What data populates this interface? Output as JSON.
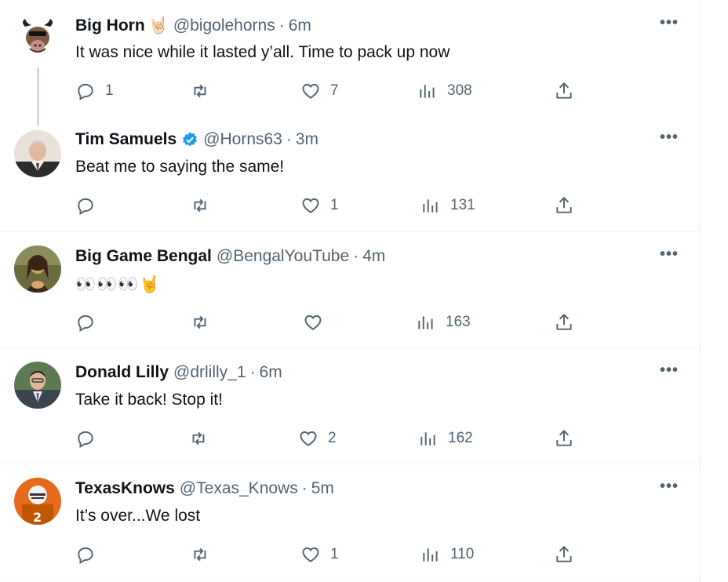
{
  "tweets": [
    {
      "name": "Big Horn",
      "name_suffix": "🤘🏻",
      "handle": "@bigolehorns",
      "time": "6m",
      "text": "It was nice while it lasted y’all. Time to pack up now",
      "replies": "1",
      "retweets": "",
      "likes": "7",
      "views": "308",
      "verified": false
    },
    {
      "name": "Tim Samuels",
      "handle": "@Horns63",
      "time": "3m",
      "text": "Beat me to saying the same!",
      "replies": "",
      "retweets": "",
      "likes": "1",
      "views": "131",
      "verified": true
    },
    {
      "name": "Big Game Bengal",
      "handle": "@BengalYouTube",
      "time": "4m",
      "text": "👀👀👀🤘",
      "replies": "",
      "retweets": "",
      "likes": "",
      "views": "163",
      "verified": false
    },
    {
      "name": "Donald Lilly",
      "handle": "@drlilly_1",
      "time": "6m",
      "text": "Take it back! Stop it!",
      "replies": "",
      "retweets": "",
      "likes": "2",
      "views": "162",
      "verified": false
    },
    {
      "name": "TexasKnows",
      "handle": "@Texas_Knows",
      "time": "5m",
      "text": "It’s over...We lost",
      "replies": "",
      "retweets": "",
      "likes": "1",
      "views": "110",
      "verified": false
    }
  ],
  "separator": "·",
  "more_label": "•••",
  "icons": {
    "reply": "reply-icon",
    "retweet": "retweet-icon",
    "like": "heart-icon",
    "views": "views-icon",
    "share": "share-icon",
    "verified": "verified-badge-icon"
  },
  "colors": {
    "text": "#0f1419",
    "secondary": "#536471",
    "verified": "#1d9bf0",
    "border": "#eff3f4",
    "thread_line": "#cfd9de"
  }
}
